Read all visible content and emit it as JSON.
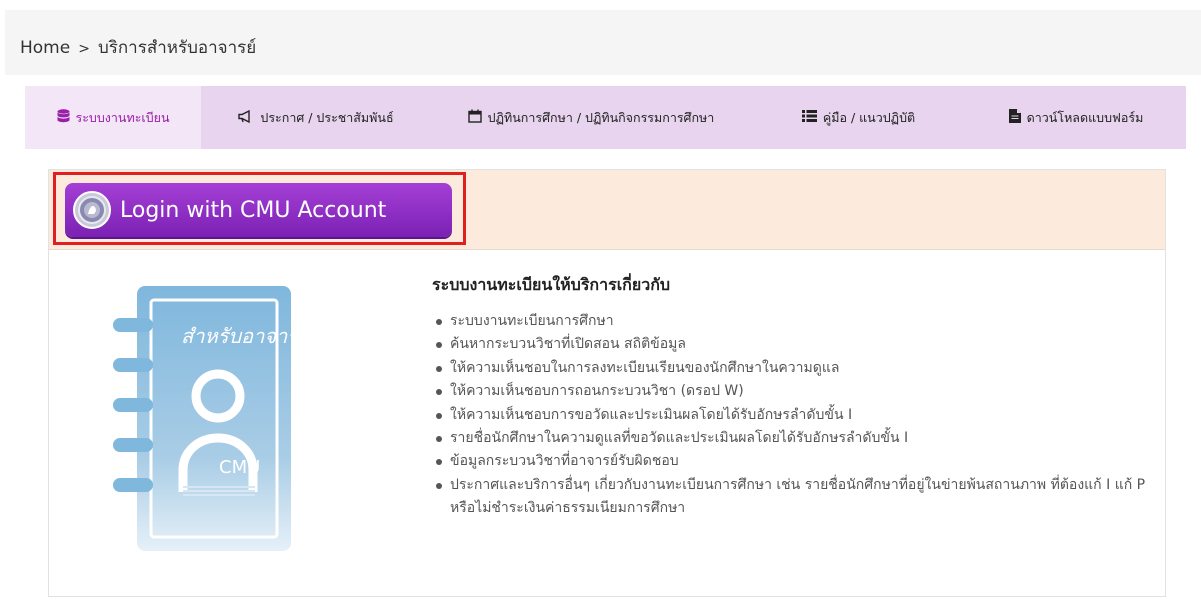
{
  "breadcrumb": {
    "home": "Home",
    "separator": ">",
    "current": "บริการสำหรับอาจารย์"
  },
  "tabs": [
    {
      "label": "ระบบงานทะเบียน",
      "icon": "database-icon",
      "active": true
    },
    {
      "label": "ประกาศ / ประชาสัมพันธ์",
      "icon": "megaphone-icon",
      "active": false
    },
    {
      "label": "ปฏิทินการศึกษา / ปฏิทินกิจกรรมการศึกษา",
      "icon": "calendar-icon",
      "active": false
    },
    {
      "label": "คู่มือ / แนวปฏิบัติ",
      "icon": "list-icon",
      "active": false
    },
    {
      "label": "ดาวน์โหลดแบบฟอร์ม",
      "icon": "file-icon",
      "active": false
    }
  ],
  "login": {
    "button_label": "Login with CMU Account",
    "icon": "cmu-seal-icon"
  },
  "illustration": {
    "label": "สำหรับอาจารย์",
    "brand": "CMU",
    "icon": "address-book-icon"
  },
  "info": {
    "heading": "ระบบงานทะเบียนให้บริการเกี่ยวกับ",
    "items": [
      "ระบบงานทะเบียนการศึกษา",
      "ค้นหากระบวนวิชาที่เปิดสอน สถิติข้อมูล",
      "ให้ความเห็นชอบในการลงทะเบียนเรียนของนักศึกษาในความดูแล",
      "ให้ความเห็นชอบการถอนกระบวนวิชา (ดรอป W)",
      "ให้ความเห็นชอบการขอวัดและประเมินผลโดยได้รับอักษรลำดับขั้น I",
      "รายชื่อนักศึกษาในความดูแลที่ขอวัดและประเมินผลโดยได้รับอักษรลำดับขั้น I",
      "ข้อมูลกระบวนวิชาที่อาจารย์รับผิดชอบ",
      "ประกาศและบริการอื่นๆ เกี่ยวกับงานทะเบียนการศึกษา เช่น รายชื่อนักศึกษาที่อยู่ในข่ายพ้นสถานภาพ ที่ต้องแก้ I แก้ P หรือไม่ชำระเงินค่าธรรมเนียมการศึกษา"
    ]
  },
  "colors": {
    "accent": "#9b1fa8",
    "tab_bar": "#e8d4ee",
    "login_band": "#fcebdc",
    "highlight": "#e02020"
  }
}
